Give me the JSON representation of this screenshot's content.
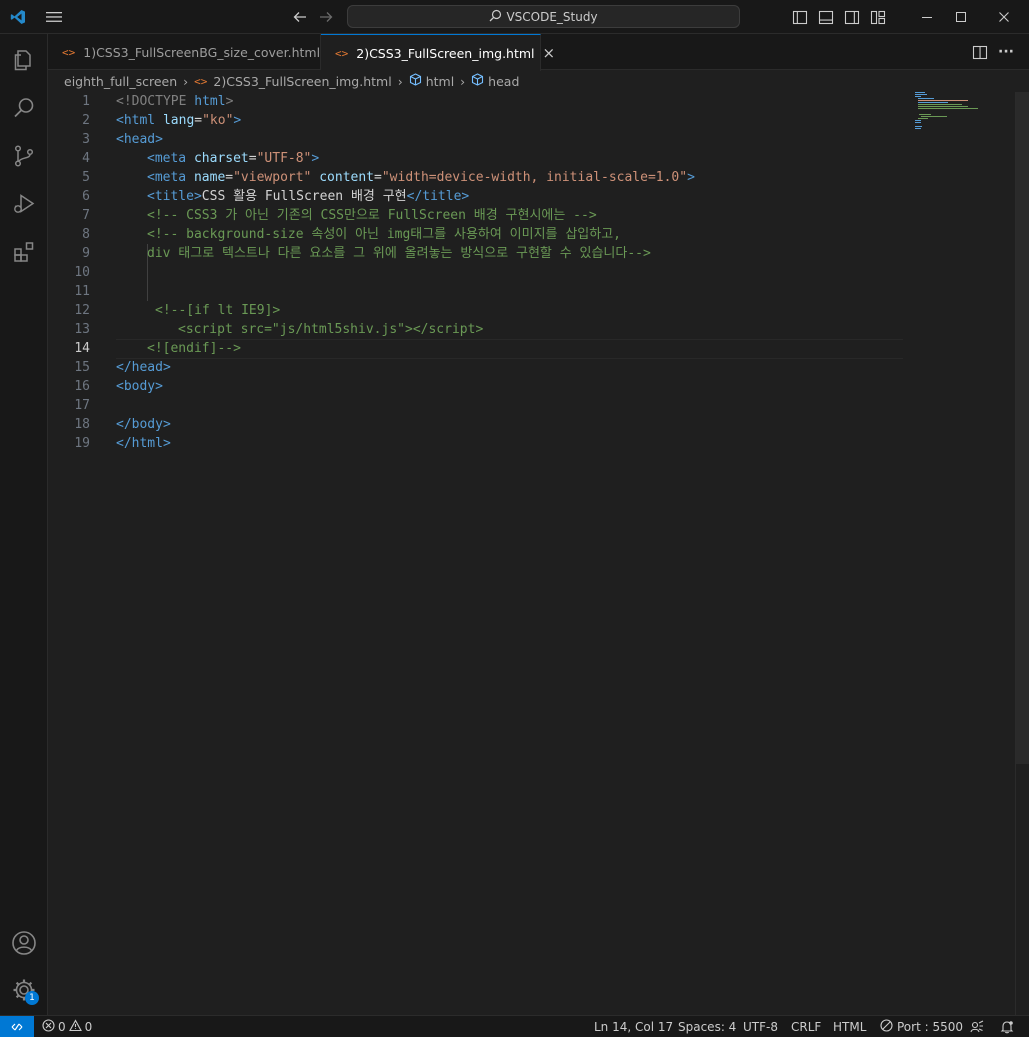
{
  "titlebar": {
    "search_text": "VSCODE_Study",
    "icons": [
      "vscode-logo-icon",
      "menu-icon",
      "back-arrow-icon",
      "forward-arrow-icon",
      "toggle-primary-sidebar-icon",
      "toggle-panel-icon",
      "toggle-secondary-sidebar-icon",
      "customize-layout-icon",
      "minimize-icon",
      "maximize-icon",
      "close-icon"
    ]
  },
  "activity_bar": {
    "items": [
      "explorer-icon",
      "search-icon",
      "source-control-icon",
      "run-debug-icon",
      "extensions-icon"
    ],
    "bottom": [
      "account-icon",
      "manage-gear-icon"
    ],
    "badge": "1"
  },
  "tabs": [
    {
      "label": "1)CSS3_FullScreenBG_size_cover.html",
      "icon": "<>",
      "active": false
    },
    {
      "label": "2)CSS3_FullScreen_img.html",
      "icon": "<>",
      "active": true
    }
  ],
  "tab_close": "×",
  "tab_actions": {
    "split": "split-editor-icon",
    "more": "···"
  },
  "breadcrumb": {
    "folder": "eighth_full_screen",
    "file": "2)CSS3_FullScreen_img.html",
    "sym1": "html",
    "sym2": "head",
    "sep": "›"
  },
  "editor": {
    "line_numbers": [
      "1",
      "2",
      "3",
      "4",
      "5",
      "6",
      "7",
      "8",
      "9",
      "10",
      "11",
      "12",
      "13",
      "14",
      "15",
      "16",
      "17",
      "18",
      "19"
    ],
    "current_line": "14",
    "lines": {
      "l1": {
        "a": "<!DOCTYPE",
        "b": " html",
        "c": ">"
      },
      "l2": {
        "a": "<html",
        "b": " lang",
        "c": "=",
        "d": "\"ko\"",
        "e": ">"
      },
      "l3": {
        "a": "<head>"
      },
      "l4": {
        "a": "<meta",
        "b": " charset",
        "c": "=",
        "d": "\"UTF-8\"",
        "e": ">"
      },
      "l5": {
        "a": "<meta",
        "b": " name",
        "c": "=",
        "d": "\"viewport\"",
        "e": " content",
        "f": "=",
        "g": "\"width=device-width, initial-scale=1.0\"",
        "h": ">"
      },
      "l6": {
        "a": "<title>",
        "b": "CSS 활용 FullScreen 배경 구현",
        "c": "</title>"
      },
      "l7": "<!-- CSS3 가 아닌 기존의 CSS만으로 FullScreen 배경 구현시에는 -->",
      "l8": "<!-- background-size 속성이 아닌 img태그를 사용하여 이미지를 삽입하고,",
      "l9": "div 태그로 텍스트나 다른 요소를 그 위에 올려놓는 방식으로 구현할 수 있습니다-->",
      "l12": "<!--[if lt IE9]>",
      "l13a": "<script src=\"js/html5shiv.js\">",
      "l13b": "</",
      "l13c": "script",
      "l13d": ">",
      "l14": "<![endif]-->",
      "l15": "</head>",
      "l16": "<body>",
      "l18": "</body>",
      "l19": "</html>"
    }
  },
  "status": {
    "errors": "0",
    "warnings": "0",
    "position": "Ln 14, Col 17",
    "spaces": "Spaces: 4",
    "encoding": "UTF-8",
    "eol": "CRLF",
    "language": "HTML",
    "port": "Port : 5500"
  },
  "colors": {
    "accent": "#0078d4",
    "tag": "#569cd6",
    "attr": "#9cdcfe",
    "string": "#ce9178",
    "comment": "#6a9955"
  }
}
